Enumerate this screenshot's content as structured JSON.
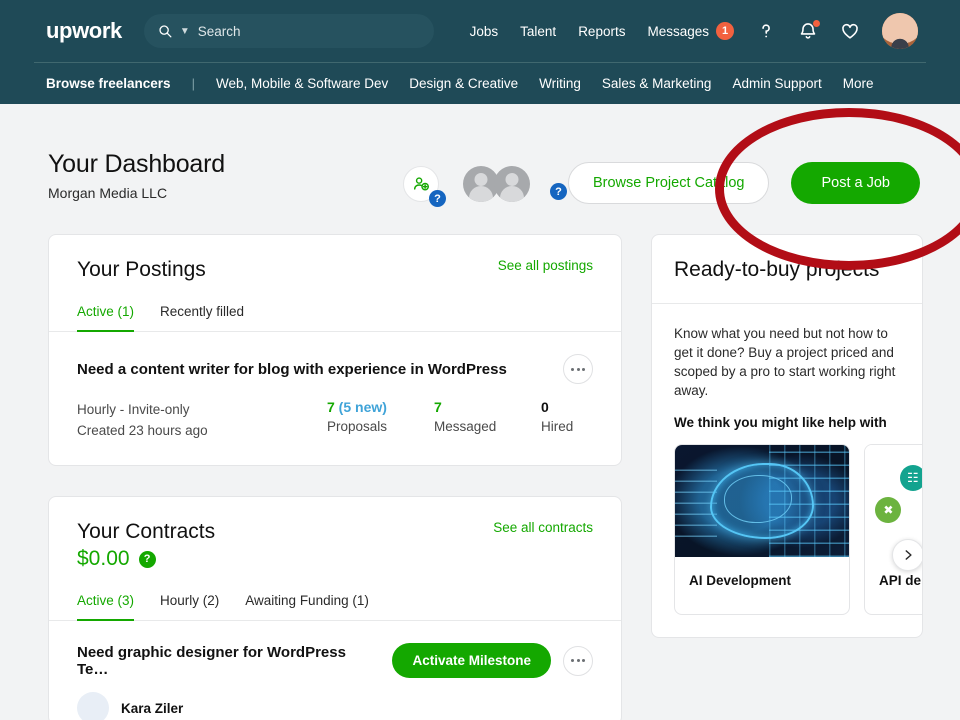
{
  "nav": {
    "logo": "upwork",
    "search_placeholder": "Search",
    "links": [
      "Jobs",
      "Talent",
      "Reports"
    ],
    "messages_label": "Messages",
    "messages_count": "1",
    "help_icon": "question-mark-icon",
    "bell_icon": "bell-icon",
    "heart_icon": "heart-icon",
    "avatar_icon": "user-avatar",
    "categories": {
      "browse": "Browse freelancers",
      "separator": "|",
      "items": [
        "Web, Mobile & Software Dev",
        "Design & Creative",
        "Writing",
        "Sales & Marketing",
        "Admin Support",
        "More"
      ]
    }
  },
  "header": {
    "title": "Your Dashboard",
    "subtitle": "Morgan Media LLC",
    "invite_help_badge": "?",
    "members_help_badge": "?",
    "browse_catalog_label": "Browse Project Catalog",
    "post_job_label": "Post a Job"
  },
  "postings": {
    "title": "Your Postings",
    "see_all_label": "See all postings",
    "tabs": [
      {
        "label": "Active (1)",
        "active": true
      },
      {
        "label": "Recently filled",
        "active": false
      }
    ],
    "item": {
      "title": "Need a content writer for blog with experience in WordPress",
      "type": "Hourly - Invite-only",
      "created": "Created 23 hours ago",
      "stats": [
        {
          "num": "7",
          "extra": " (5 new)",
          "label": "Proposals",
          "color": "green"
        },
        {
          "num": "7",
          "extra": "",
          "label": "Messaged",
          "color": "green"
        },
        {
          "num": "0",
          "extra": "",
          "label": "Hired",
          "color": "black"
        }
      ]
    }
  },
  "contracts": {
    "title": "Your Contracts",
    "see_all_label": "See all contracts",
    "amount": "$0.00",
    "amount_help_badge": "?",
    "tabs": [
      {
        "label": "Active (3)",
        "active": true
      },
      {
        "label": "Hourly (2)",
        "active": false
      },
      {
        "label": "Awaiting Funding (1)",
        "active": false
      }
    ],
    "item": {
      "title": "Need graphic designer for WordPress Te…",
      "action_label": "Activate Milestone",
      "person_name": "Kara Ziler"
    }
  },
  "ready_to_buy": {
    "title": "Ready-to-buy projects",
    "copy": "Know what you need but not how to get it done? Buy a project priced and scoped by a pro to start working right away.",
    "subheading": "We think you might like help with",
    "projects": [
      {
        "name": "AI Development",
        "image": "ai-brain-circuit-image"
      },
      {
        "name": "API de",
        "image": "api-development-image"
      }
    ],
    "next_icon": "chevron-right-icon"
  },
  "annotation": {
    "shape": "red-ellipse-highlight",
    "color": "#b20d16"
  },
  "colors": {
    "nav_bg": "#1f4a57",
    "accent_green": "#14a800",
    "badge_orange": "#f2613f",
    "help_blue": "#1565c0",
    "annotation_red": "#b20d16"
  }
}
